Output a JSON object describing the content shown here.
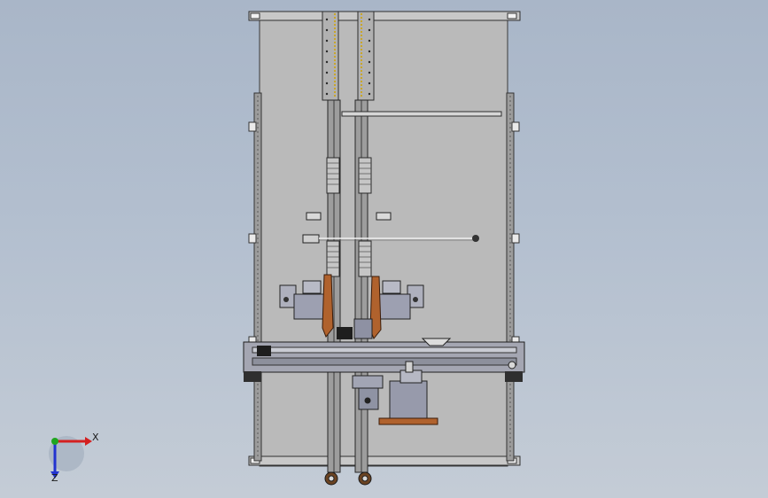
{
  "window": {
    "title": ""
  },
  "colors": {
    "background_top": "#a9b6c8",
    "background_bottom": "#c4ccd6",
    "frame_panel": "#b9b9b9",
    "frame_edge": "#3a3a3a",
    "rail": "#8e8e8e",
    "beam": "#a8a8b4",
    "bracket_orange": "#b0622d",
    "motor_blue": "#8b8fa3",
    "triad_x": "#d42020",
    "triad_y": "#1fa51f",
    "triad_z": "#2233d0"
  },
  "triad": {
    "x_label": "X",
    "z_label": "Z",
    "icons": [
      "axis-x-arrow-icon",
      "axis-y-point-icon",
      "axis-z-arrow-icon"
    ]
  }
}
